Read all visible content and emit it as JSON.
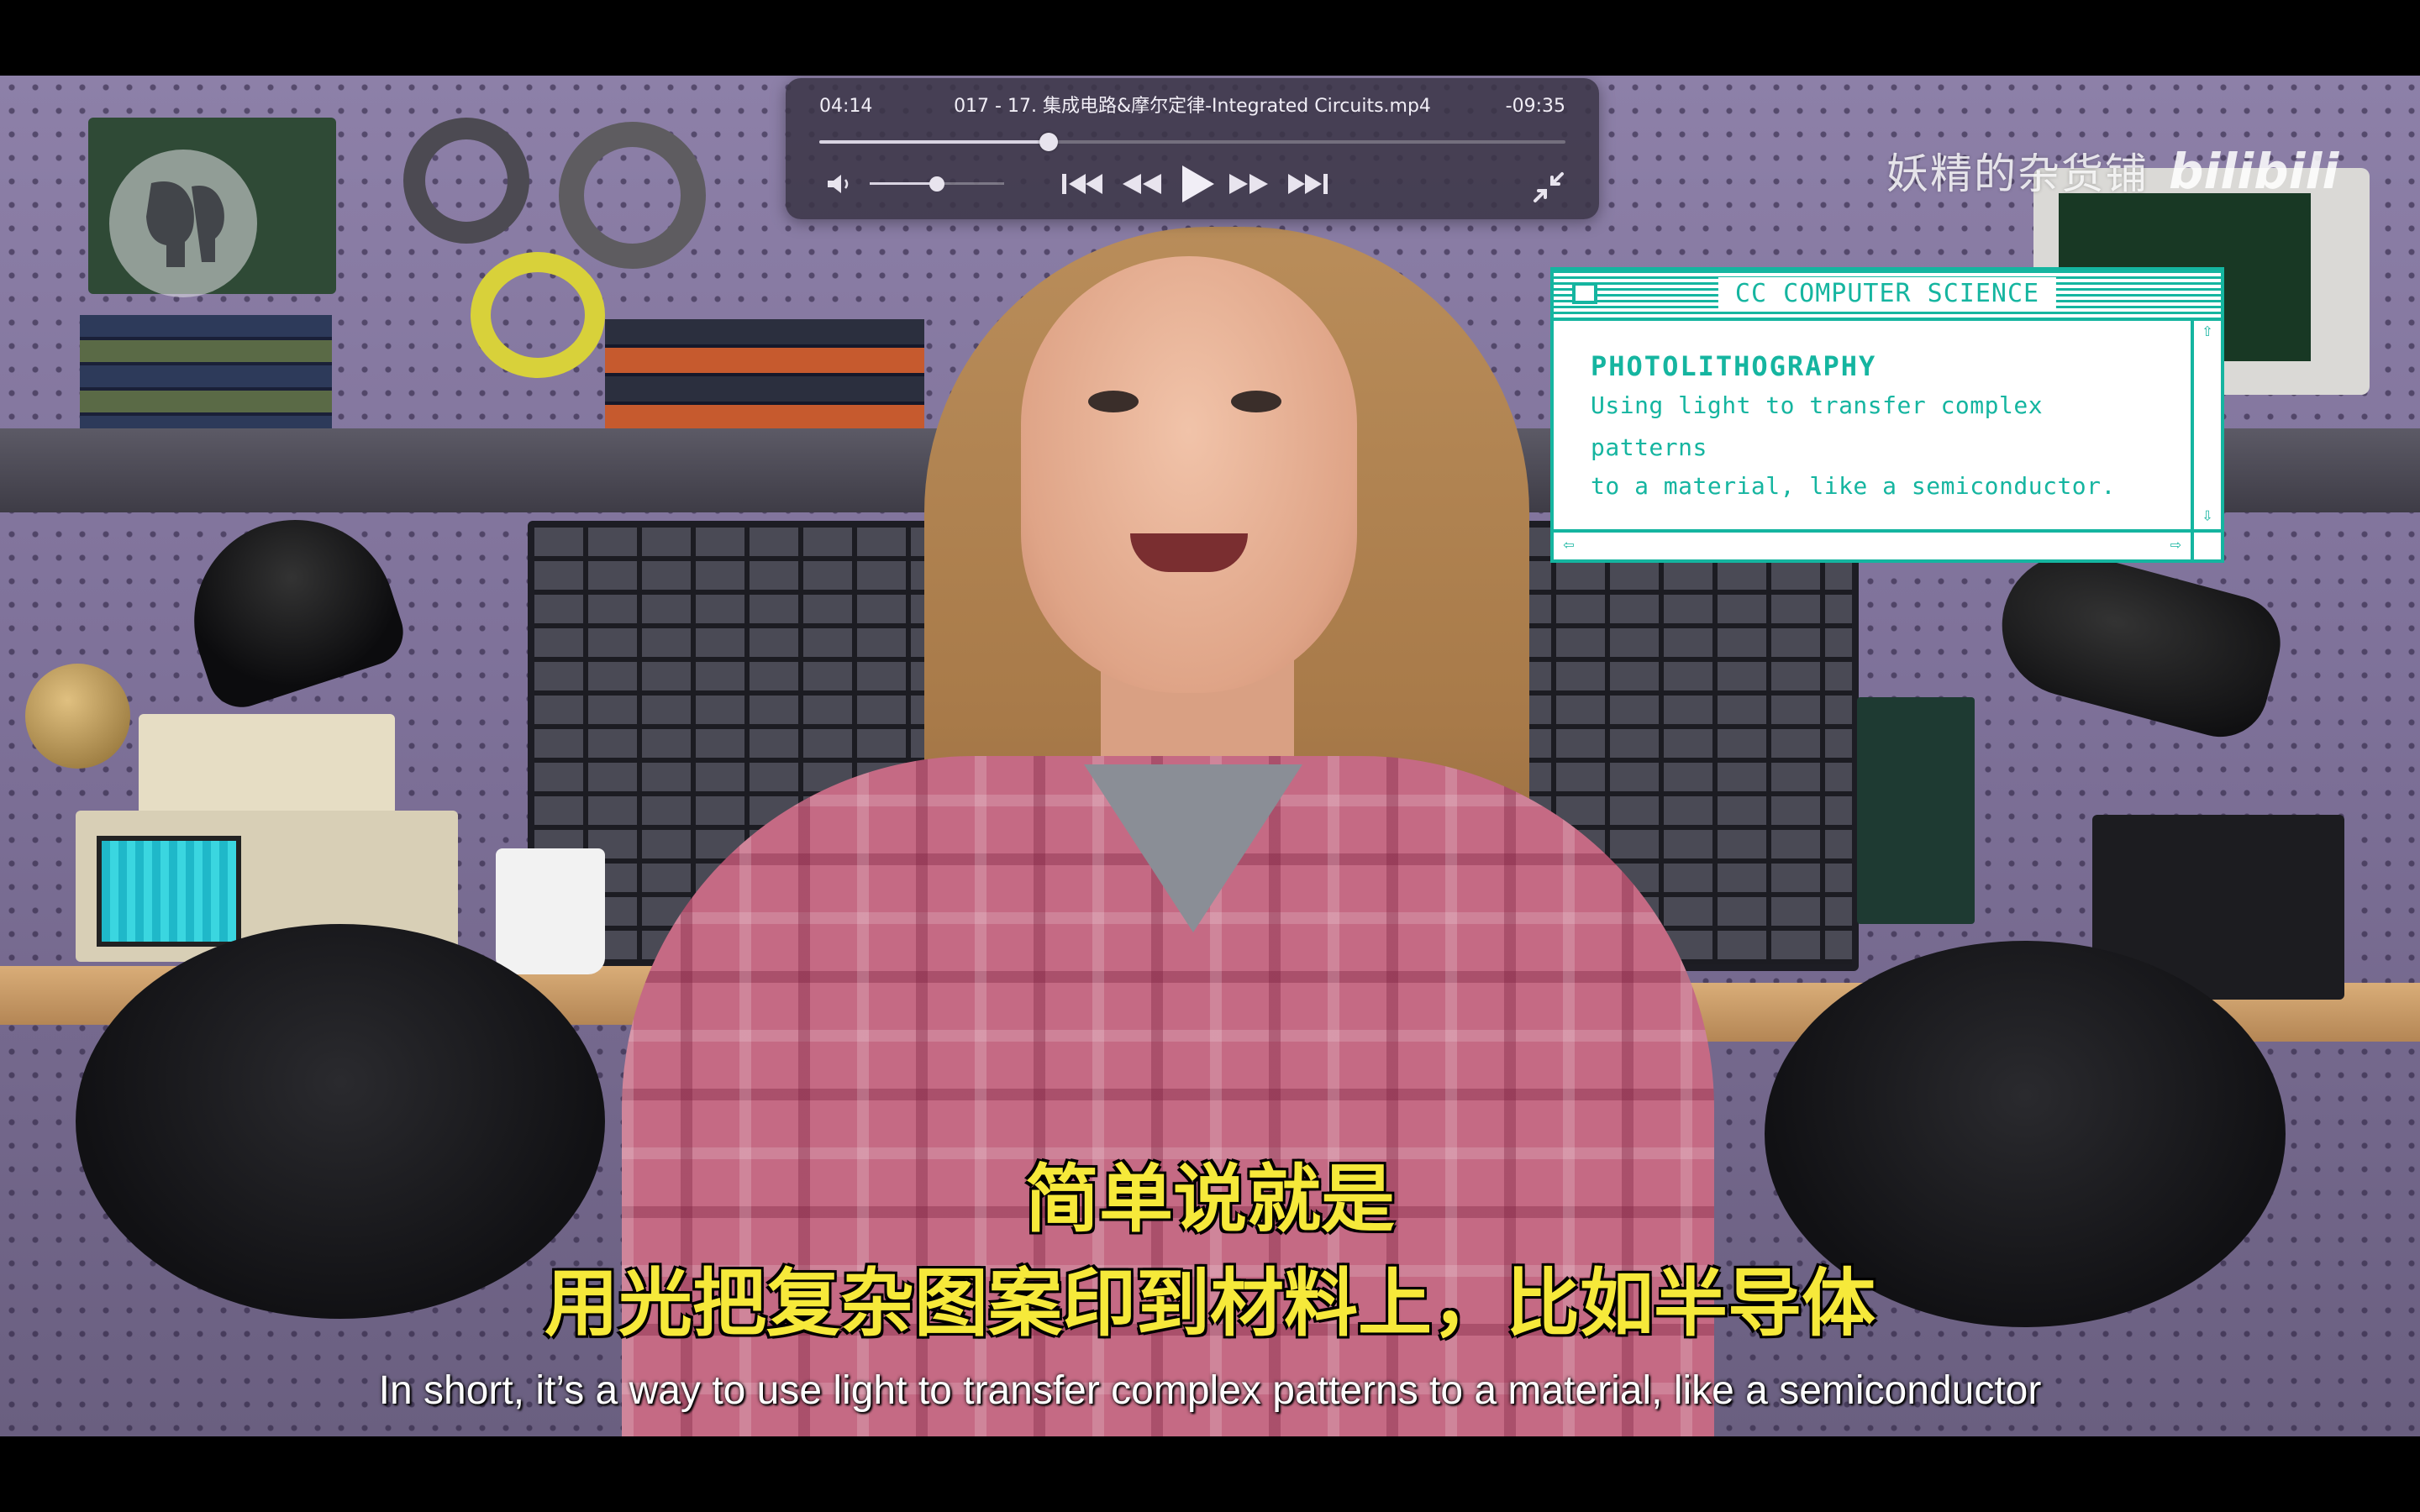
{
  "player": {
    "elapsed": "04:14",
    "remaining": "-09:35",
    "title": "017 - 17. 集成电路&摩尔定律-Integrated Circuits.mp4",
    "progress_fraction": 0.307,
    "volume_fraction": 0.5,
    "controls": {
      "volume_icon": "speaker-icon",
      "skip_back_icon": "skip-back-icon",
      "rewind_icon": "rewind-icon",
      "play_icon": "play-icon",
      "forward_icon": "fast-forward-icon",
      "skip_forward_icon": "skip-forward-icon",
      "exit_fullscreen_icon": "exit-fullscreen-icon"
    },
    "colors": {
      "bar_bg": "#3a3446",
      "text": "#f1eef6"
    }
  },
  "watermark": {
    "channel": "妖精的杂货铺",
    "brand": "bilibili"
  },
  "overlay": {
    "window_title": "CC COMPUTER SCIENCE",
    "heading": "PHOTOLITHOGRAPHY",
    "body_line_1": "Using light to transfer complex patterns",
    "body_line_2": "to a material, like a semiconductor.",
    "accent_color": "#15b5a0"
  },
  "subtitles": {
    "cn_line_1": "简单说就是",
    "cn_line_2": "用光把复杂图案印到材料上，比如半导体",
    "en_line": "In short, it’s a way to use light to transfer complex patterns to a material, like a semiconductor",
    "cn_color": "#f6e93a"
  }
}
